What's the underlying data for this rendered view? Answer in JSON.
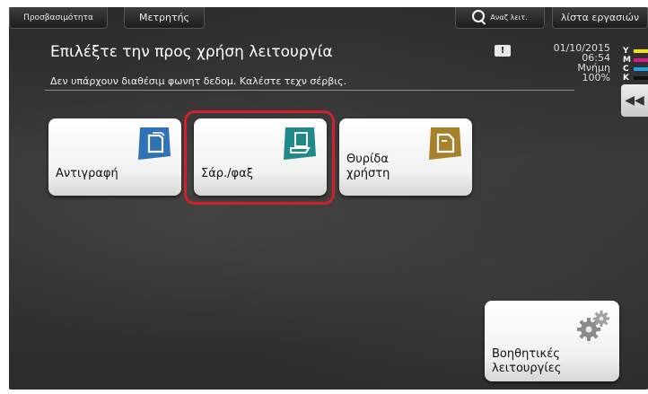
{
  "header": {
    "accessibility_label": "Προσβασιμότητα",
    "counter_label": "Μετρητής",
    "search_label": "Αναζ λειτ.",
    "job_list_label": "λίστα εργασιών"
  },
  "status": {
    "title": "Επιλέξτε την προς χρήση λειτουργία",
    "message": "Δεν υπάρχουν διαθέσιμ φωνητ δεδομ. Καλέστε τεχν σέρβις.",
    "date": "01/10/2015",
    "time": "06:54",
    "memory_label": "Μνήμη",
    "memory_value": "100%",
    "toner": [
      {
        "letter": "Y",
        "color": "#f2e600"
      },
      {
        "letter": "M",
        "color": "#e0168c"
      },
      {
        "letter": "C",
        "color": "#1aa3e6"
      },
      {
        "letter": "K",
        "color": "#111111"
      }
    ]
  },
  "tiles": {
    "copy": "Αντιγραφή",
    "scan_fax": "Σάρ./φαξ",
    "user_box_line1": "Θυρίδα",
    "user_box_line2": "χρήστη",
    "utility_line1": "Βοηθητικές",
    "utility_line2": "λειτουργίες"
  },
  "colors": {
    "highlight": "#d0202a",
    "icon_blue": "#2f72b6",
    "icon_teal": "#1f8a88",
    "icon_gold": "#a8822a"
  }
}
